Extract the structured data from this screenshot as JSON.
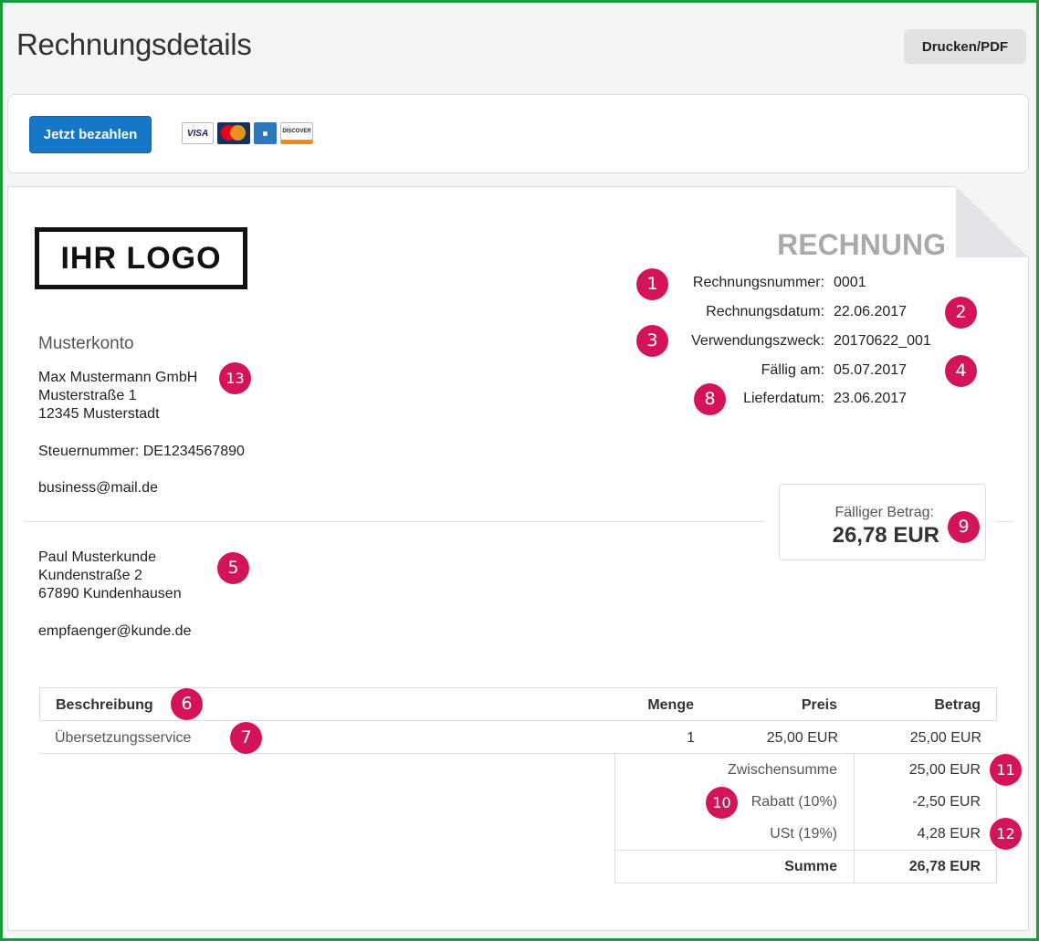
{
  "header": {
    "title": "Rechnungsdetails",
    "print_label": "Drucken/PDF"
  },
  "payment": {
    "pay_label": "Jetzt bezahlen",
    "cards": [
      "VISA",
      "MasterCard",
      "AMERICAN EXPRESS",
      "DISCOVER"
    ]
  },
  "invoice": {
    "logo_text": "IHR LOGO",
    "heading": "RECHNUNG",
    "meta": [
      {
        "label": "Rechnungsnummer:",
        "value": "0001"
      },
      {
        "label": "Rechnungsdatum:",
        "value": "22.06.2017"
      },
      {
        "label": "Verwendungszweck:",
        "value": "20170622_001"
      },
      {
        "label": "Fällig am:",
        "value": "05.07.2017"
      },
      {
        "label": "Lieferdatum:",
        "value": "23.06.2017"
      }
    ],
    "account": "Musterkonto",
    "sender": {
      "company": "Max Mustermann GmbH",
      "street": "Musterstraße 1",
      "city": "12345 Musterstadt",
      "tax": "Steuernummer: DE1234567890",
      "email": "business@mail.de"
    },
    "due": {
      "label": "Fälliger Betrag:",
      "amount": "26,78 EUR"
    },
    "recipient": {
      "name": "Paul Musterkunde",
      "street": "Kundenstraße 2",
      "city": "67890 Kundenhausen",
      "email": "empfaenger@kunde.de"
    },
    "table": {
      "headers": {
        "description": "Beschreibung",
        "qty": "Menge",
        "price": "Preis",
        "amount": "Betrag"
      },
      "rows": [
        {
          "description": "Übersetzungsservice",
          "qty": "1",
          "price": "25,00 EUR",
          "amount": "25,00 EUR"
        }
      ]
    },
    "totals": {
      "subtotal_label": "Zwischensumme",
      "subtotal": "25,00 EUR",
      "discount_label": "Rabatt (10%)",
      "discount": "-2,50 EUR",
      "vat_label": "USt (19%)",
      "vat": "4,28 EUR",
      "sum_label": "Summe",
      "sum": "26,78 EUR"
    }
  },
  "badges": [
    "1",
    "2",
    "3",
    "4",
    "8",
    "13",
    "9",
    "5",
    "6",
    "7",
    "11",
    "10",
    "12"
  ]
}
